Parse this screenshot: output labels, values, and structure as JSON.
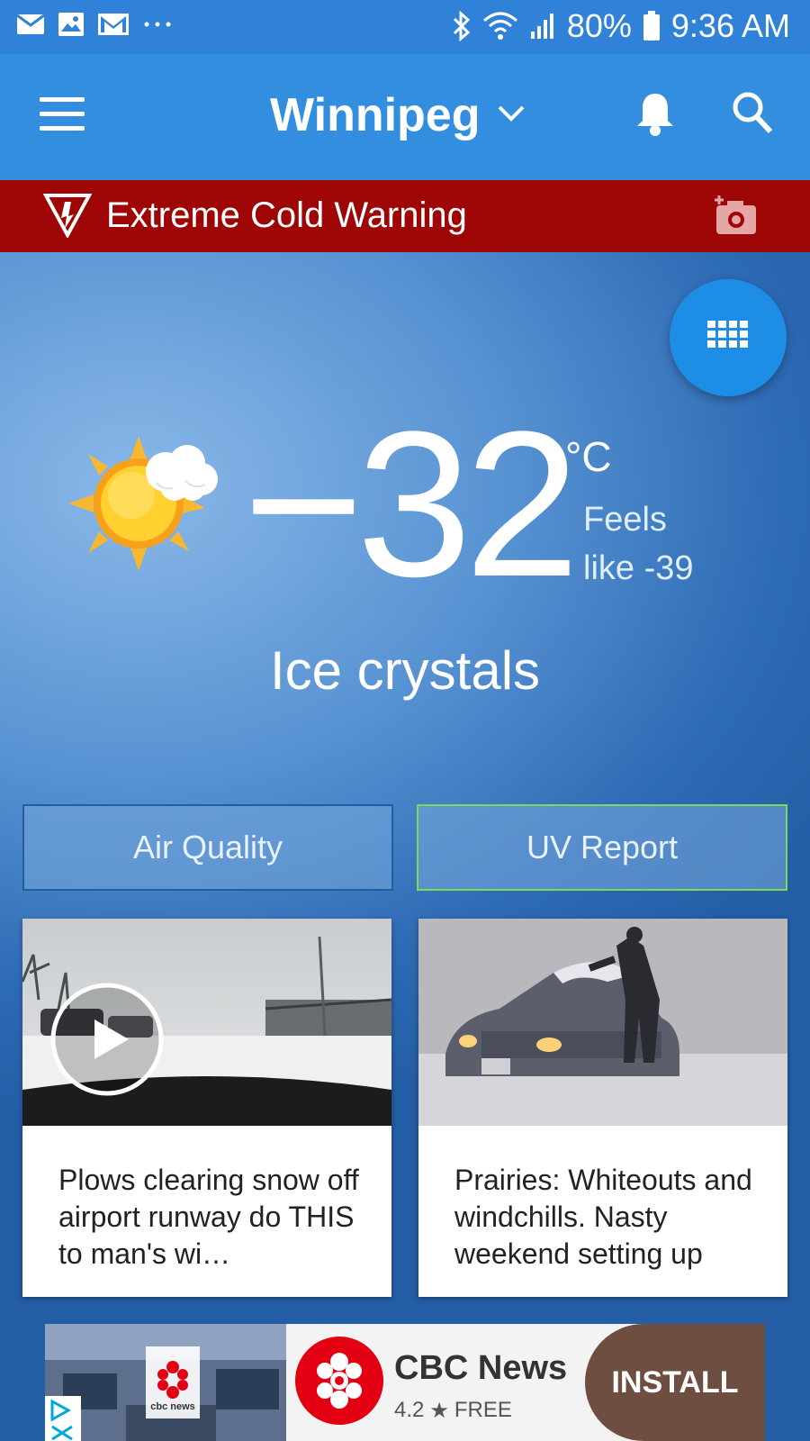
{
  "status_bar": {
    "battery": "80%",
    "time": "9:36 AM",
    "left_icons": [
      "mail-icon",
      "image-icon",
      "gmail-icon",
      "more-dots-icon"
    ],
    "right_icons": [
      "bluetooth-icon",
      "wifi-icon",
      "signal-icon",
      "battery-icon"
    ]
  },
  "app_bar": {
    "city": "Winnipeg",
    "icons": [
      "menu-icon",
      "chevron-down-icon",
      "bell-icon",
      "search-icon"
    ]
  },
  "warning": {
    "text": "Extreme Cold Warning",
    "color": "#9e0505",
    "icons": [
      "warning-triangle-icon",
      "add-photo-icon"
    ]
  },
  "current": {
    "temperature": "−32",
    "unit": "°C",
    "feels_like": "Feels like -39",
    "condition": "Ice crystals",
    "icon": "sun-cloud-icon"
  },
  "buttons": {
    "air_quality": "Air Quality",
    "uv_report": "UV Report"
  },
  "news": [
    {
      "title": "Plows clearing snow off airport runway do THIS to man's wi…",
      "type": "video"
    },
    {
      "title": "Prairies: Whiteouts and windchills. Nasty weekend setting up",
      "type": "article"
    }
  ],
  "ad": {
    "app_name": "CBC News",
    "rating": "4.2",
    "price": "FREE",
    "cta": "INSTALL",
    "brand_mark": "cbc news"
  },
  "colors": {
    "status_bar": "#2f82d8",
    "app_bar": "#338ee0",
    "fab": "#1e8de6",
    "install": "#6f4e42"
  }
}
